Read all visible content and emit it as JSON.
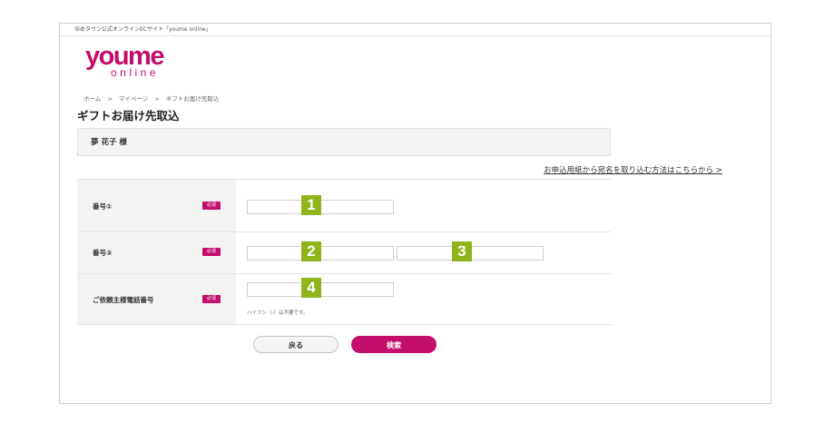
{
  "header": {
    "site_caption": "ゆめタウン公式オンラインECサイト「youme online」",
    "logo_main": "youme",
    "logo_sub": "online"
  },
  "breadcrumb": {
    "items": [
      "ホーム",
      "マイページ",
      "ギフトお届け先取込"
    ],
    "separator": ">"
  },
  "page": {
    "title": "ギフトお届け先取込",
    "recipient_name": "夢 花子 様",
    "method_link": "お申込用紙から宛名を取り込む方法はこちらから >"
  },
  "form": {
    "required_label": "必須",
    "rows": [
      {
        "label": "番号①",
        "markers": [
          "1"
        ]
      },
      {
        "label": "番号②",
        "markers": [
          "2",
          "3"
        ]
      },
      {
        "label": "ご依頼主様電話番号",
        "markers": [
          "4"
        ],
        "hint": "ハイフン（-）は不要です。"
      }
    ]
  },
  "buttons": {
    "back": "戻る",
    "search": "検索"
  },
  "colors": {
    "brand": "#c20e6c",
    "marker": "#8fb51a",
    "label_bg": "#f3f3f1"
  }
}
